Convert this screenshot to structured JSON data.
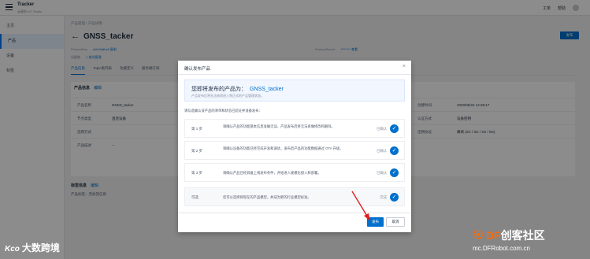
{
  "topbar": {
    "title": "Tracker",
    "subtitle": "云服务 IoT Studio",
    "right_items": [
      "工单",
      "帮助"
    ]
  },
  "sidebar": {
    "items": [
      {
        "label": "主页",
        "active": false
      },
      {
        "label": "产品",
        "active": true
      },
      {
        "label": "设备",
        "active": false
      },
      {
        "label": "标签",
        "active": false
      }
    ]
  },
  "main": {
    "breadcrumb": "产品管理  /  产品详情",
    "title": "GNSS_tacker",
    "publish_label": "发布",
    "meta": {
      "product_key_label": "ProductKey",
      "product_key_value": "a1fu2a6hx8 复制",
      "device_count_label": "设备数",
      "device_count_value": "1  前往管理",
      "product_secret_label": "ProductSecret",
      "product_secret_value": "******** 查看"
    },
    "tabs": [
      "产品信息",
      "Topic类列表",
      "功能定义",
      "服务端订阅"
    ],
    "info": {
      "heading": "产品信息",
      "edit": "编辑",
      "rows": [
        {
          "k": "产品名称",
          "v": "GNSS_tacker",
          "k2": "创建时间",
          "v2": "2020/05/22 14:28:17"
        },
        {
          "k": "节点类型",
          "v": "直连设备",
          "k2": "认证方式",
          "v2": "设备密钥"
        },
        {
          "k": "连网方式",
          "v": "",
          "k2": "连网协议",
          "v2": "蜂窝 (2G / 3G / 4G / 5G)"
        },
        {
          "k": "产品描述",
          "v": "--",
          "k2": "",
          "v2": ""
        }
      ]
    },
    "tags": {
      "heading": "标签信息",
      "edit": "编辑",
      "line": "产品标签：无标签信息"
    }
  },
  "modal": {
    "title": "确认发布产品",
    "close_icon": "close-icon",
    "banner_title": "您即将发布的产品为：",
    "banner_product": "GNSS_tacker",
    "banner_note": "产品发布后将无法修改进入到正式的产品管理状态。",
    "instruction": "请勾选确认该产品的清单和状态已验证并准备发布：",
    "steps": [
      {
        "label": "第 1 步",
        "desc": "请确认产品的功能基本信息准确无误，产品发布后将无法再做修改和删除。",
        "status": "已确认"
      },
      {
        "label": "第 2 步",
        "desc": "请确认设备的功能已经完成开发和调试，发布后产品的功能数据通过 OTA 升级。",
        "status": "已确认"
      },
      {
        "label": "第 3 步",
        "desc": "请确认产品已经具备上线发布条件，开始进入规模化接入和部署。",
        "status": "已确认"
      },
      {
        "label": "可选",
        "desc": "您可以选择将现在的产品模型，并成为新的行业模型标准。",
        "status": "完成"
      }
    ],
    "publish_label": "发布",
    "cancel_label": "取消"
  },
  "watermark": {
    "left": "大数跨境",
    "left_logo": "Kco",
    "right_brand": "DF",
    "right_title": "创客社区",
    "right_url": "mc.DFRobot.com.cn"
  },
  "colors": {
    "accent": "#0070cc",
    "arrow": "#e02020",
    "overlay": "rgba(0,0,0,0.45)"
  }
}
